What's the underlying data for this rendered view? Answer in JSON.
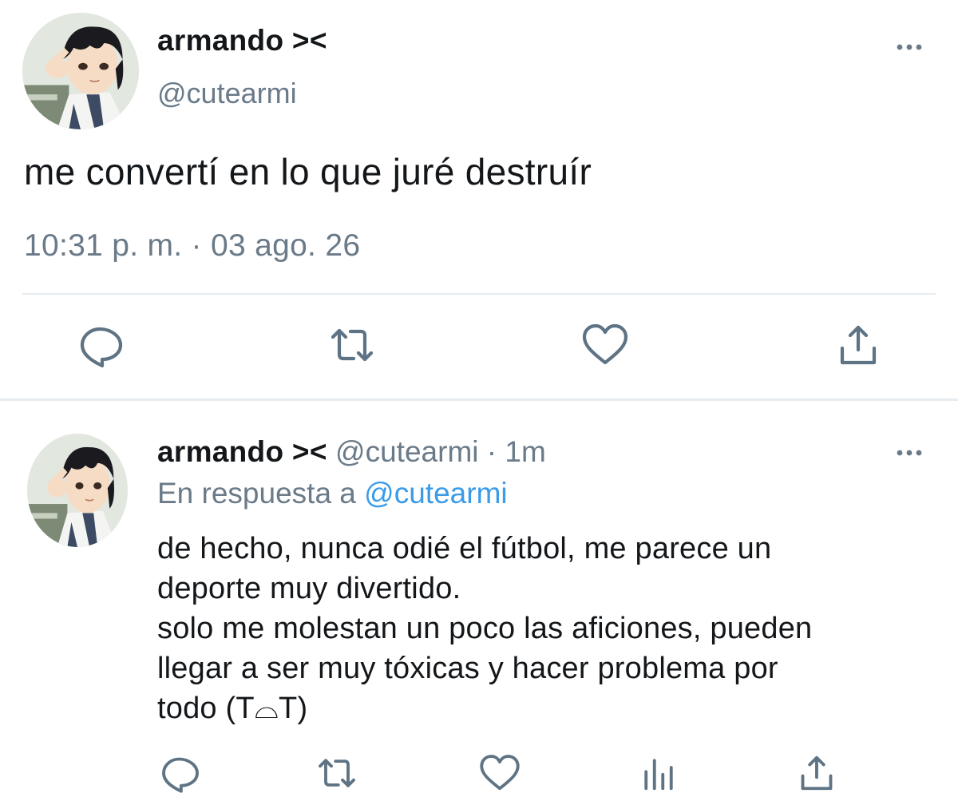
{
  "tweet1": {
    "author_name": "armando ><",
    "author_handle": "@cutearmi",
    "text": "me convertí en lo que juré destruír",
    "timestamp": "10:31 p. m. · 03 ago. 26",
    "more_icon": "more-horizontal-icon",
    "actions": [
      "reply-icon",
      "retweet-icon",
      "like-icon",
      "share-icon"
    ]
  },
  "tweet2": {
    "author_name": "armando ><",
    "author_handle": "@cutearmi",
    "separator": " · ",
    "relative_time": "1m",
    "reply_prefix": "En respuesta a ",
    "reply_to": "@cutearmi",
    "body_lines": [
      "de hecho, nunca odié el fútbol, me parece un",
      "deporte muy divertido.",
      "solo me molestan un poco las aficiones, pueden",
      "llegar a ser muy tóxicas y hacer problema por",
      "todo (T⌓T)"
    ],
    "more_icon": "more-horizontal-icon",
    "actions": [
      "reply-icon",
      "retweet-icon",
      "like-icon",
      "stats-icon",
      "share-icon"
    ]
  },
  "colors": {
    "text": "#14171a",
    "secondary": "#6a7a88",
    "link": "#3a9be8",
    "divider": "#e6ecf0",
    "icon": "#5e7384"
  }
}
